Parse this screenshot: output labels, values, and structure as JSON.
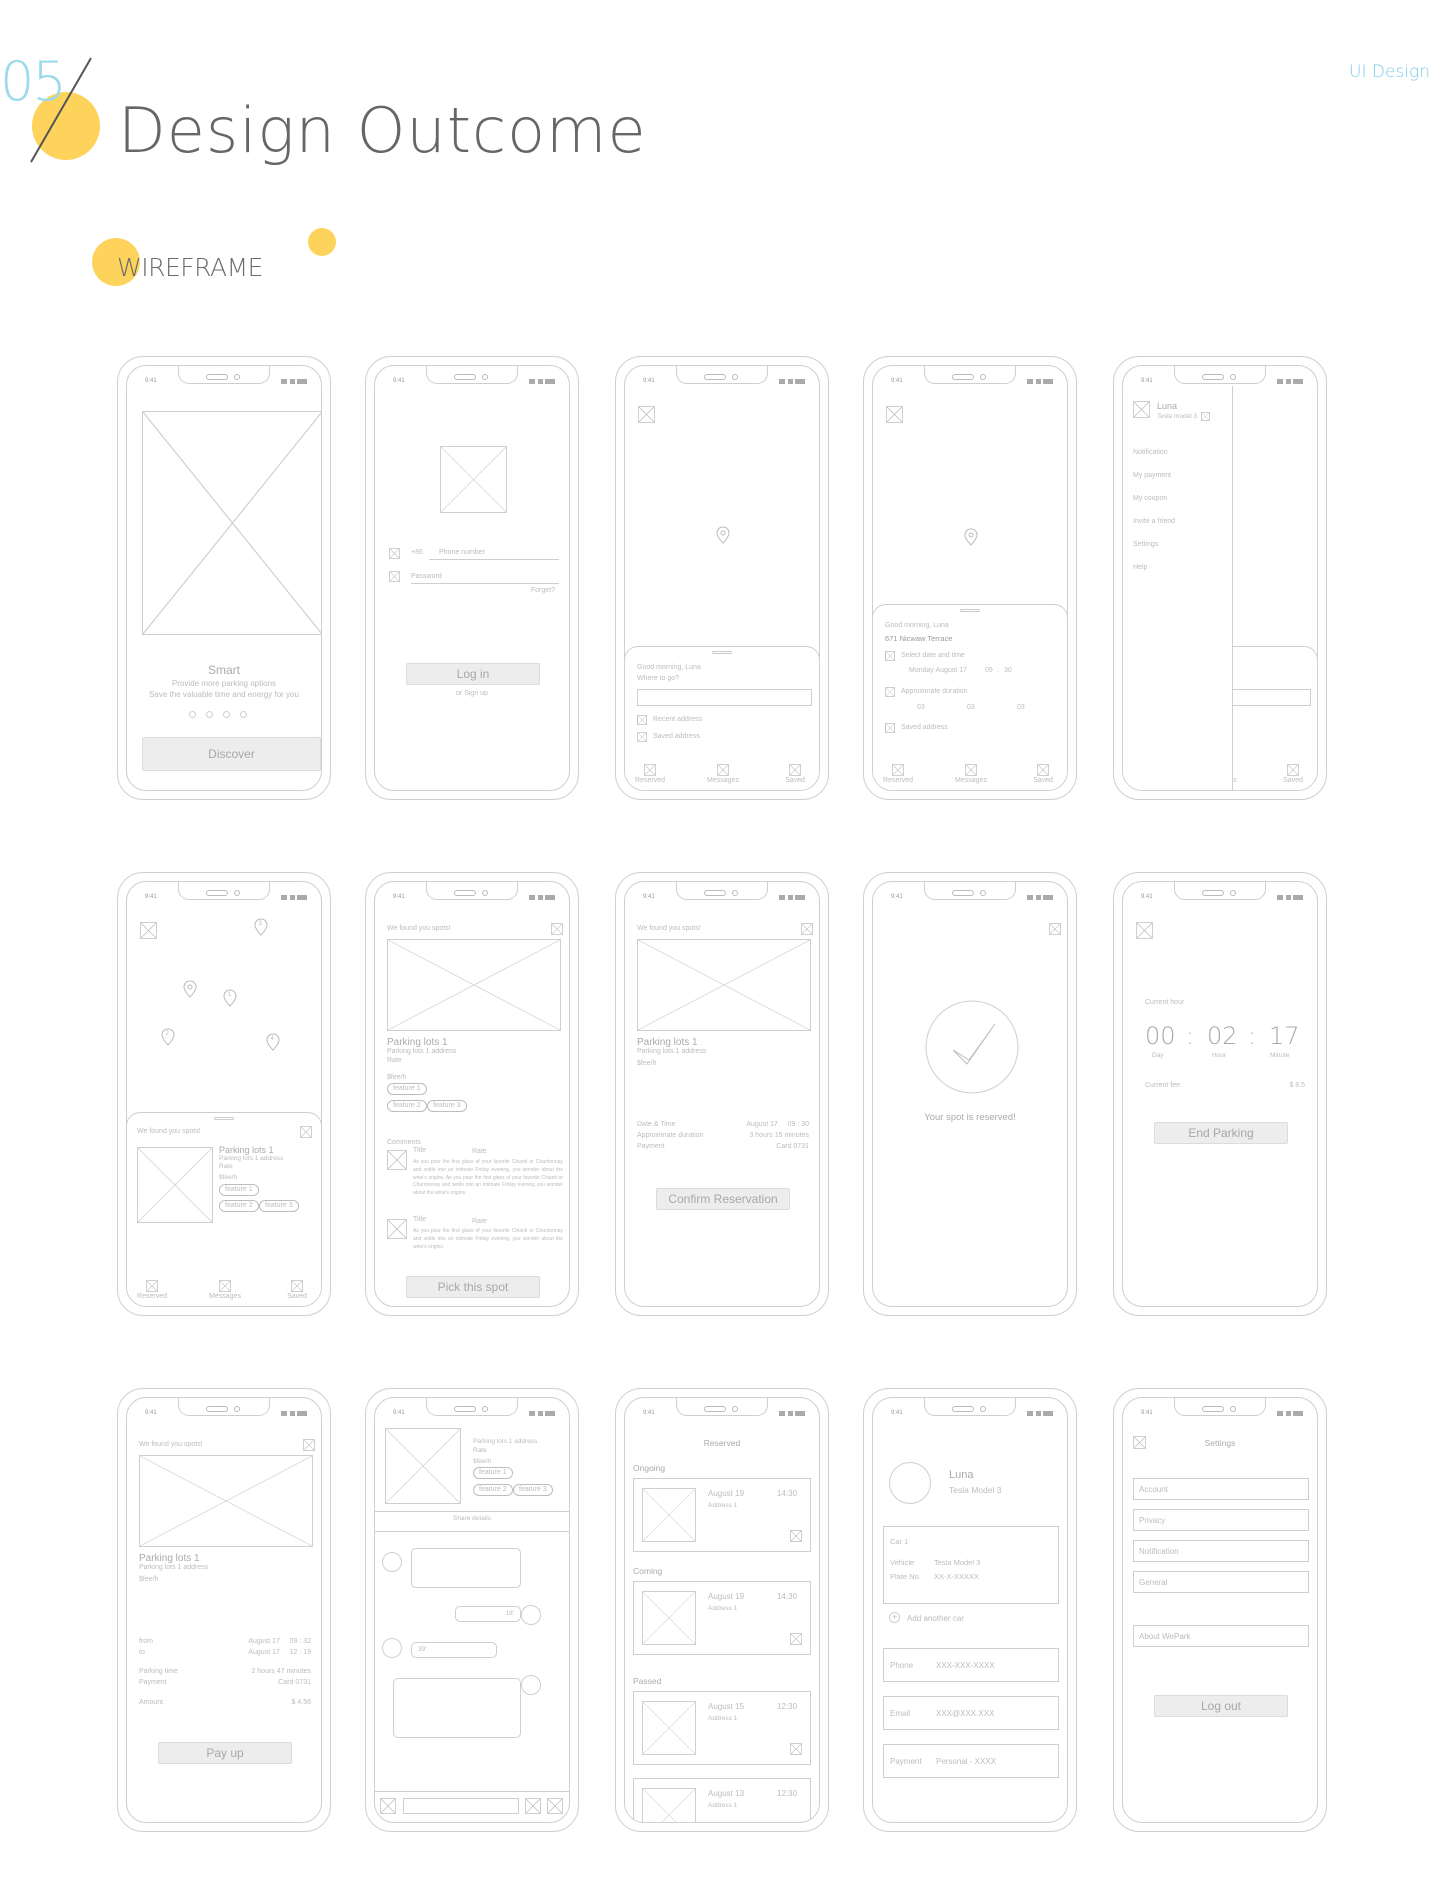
{
  "header": {
    "section_number": "05",
    "title": "Design Outcome",
    "tag": "UI Design",
    "subsection": "WIREFRAME"
  },
  "status_time": "9:41",
  "colors": {
    "accent_yellow": "#fdd35b",
    "accent_blue": "#9ad9ee",
    "wire": "#cfcfcf"
  },
  "tabs": {
    "reserved": "Reserved",
    "messages": "Messages",
    "saved": "Saved"
  },
  "s1": {
    "title": "Smart",
    "line1": "Provide more parking options",
    "line2": "Save the valuable time and energy for you",
    "button": "Discover"
  },
  "s2": {
    "code": "+86",
    "phone_placeholder": "Phone number",
    "password_placeholder": "Password",
    "forget": "Forget?",
    "login": "Log in",
    "signup": "or Sign up"
  },
  "s3": {
    "greeting": "Good morning, Luna",
    "question": "Where to go?",
    "recent": "Recent address",
    "saved": "Saved address"
  },
  "s4": {
    "greeting": "Good morning, Luna",
    "address": "671 Nicwaw Terrace",
    "select_dt": "Select date and time",
    "date": "Monday August 17",
    "hh": "09",
    "colon": ":",
    "mm": "30",
    "approx": "Approximate duration",
    "d1": "03",
    "d2": "03",
    "d3": "03",
    "saved": "Saved address"
  },
  "s5": {
    "name": "Luna",
    "car": "Tesla model 3",
    "menu": [
      "Notification",
      "My payment",
      "My coupon",
      "Invite a friend",
      "Settings",
      "Help"
    ],
    "partial_tab": "s"
  },
  "s6": {
    "pins": [
      "3",
      "1",
      "2",
      "4"
    ],
    "found": "We found you spots!",
    "lot": "Parking lots 1",
    "address": "Parking lots 1 address",
    "rate": "Rate",
    "fee": "$fee/h",
    "f1": "feature 1",
    "f2": "feature 2",
    "f3": "feature 3"
  },
  "s7": {
    "found": "We found you spots!",
    "lot": "Parking lots 1",
    "address": "Parking lots 1 address",
    "rate": "Rate",
    "fee": "$fee/h",
    "f1": "feature 1",
    "f2": "feature 2",
    "f3": "feature 3",
    "comments": "Comments",
    "c_title": "Title",
    "c_rate": "Rate",
    "c_body1": "As you pour the first glass of your favorite Chianti or Chardonnay and settle into an intimate Friday evening, you wonder about the wine's origins. As you pour the first glass of your favorite Chianti or Chardonnay and settle into an intimate Friday evening you wonder about the wine's origins.",
    "c_body2": "As you pour the first glass of your favorite Chianti or Chardonnay and settle into an intimate Friday evening, you wonder about the wine's origins.",
    "button": "Pick this spot"
  },
  "s8": {
    "found": "We found you spots!",
    "lot": "Parking lots 1",
    "address": "Parking lots 1 address",
    "fee": "$fee/h",
    "dt_label": "Date & Time",
    "dt_value": "August 17     09 : 30",
    "dur_label": "Approximate duration",
    "dur_value": "3 hours 15 minutes",
    "pay_label": "Payment",
    "pay_value": "Card 0731",
    "button": "Confirm Reservation"
  },
  "s9": {
    "message": "Your spot is reserved!"
  },
  "s10": {
    "current_hour": "Current hour",
    "h": "00",
    "m": "02",
    "s": "17",
    "sep": ":",
    "l1": "Day",
    "l2": "Hour",
    "l3": "Minute",
    "fee_label": "Current fee",
    "fee_value": "$ 8.5",
    "button": "End Parking"
  },
  "s11": {
    "found": "We found you spots!",
    "lot": "Parking lots 1",
    "address": "Parking lots 1 address",
    "fee": "$fee/h",
    "from": "from",
    "from_v": "August 17     09 : 32",
    "to": "to",
    "to_v": "August 17     12 : 19",
    "ptime": "Parking time",
    "ptime_v": "2 hours 47 minutes",
    "pay": "Payment",
    "pay_v": "Card 0731",
    "amount": "Amount",
    "amount_v": "$ 4.56",
    "button": "Pay up"
  },
  "s12": {
    "address": "Parking lots 1 address",
    "rate": "Rate",
    "fee": "$fee/h",
    "f1": "feature 1",
    "f2": "feature 2",
    "f3": "feature 3",
    "share": "Share details",
    "b1": "18'",
    "b2": "39'"
  },
  "s13": {
    "title": "Reserved",
    "ongoing": "Ongoing",
    "coming": "Coming",
    "passed": "Passed",
    "items": [
      {
        "date": "August 19",
        "time": "14:30",
        "addr": "Address 1"
      },
      {
        "date": "August 19",
        "time": "14:30",
        "addr": "Address 1"
      },
      {
        "date": "August 15",
        "time": "12:30",
        "addr": "Address 1"
      },
      {
        "date": "August 13",
        "time": "12:30",
        "addr": "Address 1"
      }
    ]
  },
  "s14": {
    "name": "Luna",
    "car": "Tesla Model 3",
    "car1": "Car 1",
    "vehicle": "Vehicle",
    "vehicle_v": "Tesla Model 3",
    "plate": "Plate No.",
    "plate_v": "XX-X-XXXXX",
    "add": "Add another car",
    "phone": "Phone",
    "phone_v": "XXX-XXX-XXXX",
    "email": "Email",
    "email_v": "XXX@XXX.XXX",
    "payment": "Payment",
    "payment_v": "Personal - XXXX"
  },
  "s15": {
    "title": "Settings",
    "items": [
      "Account",
      "Privacy",
      "Notification",
      "General"
    ],
    "about": "About WePark",
    "logout": "Log out"
  }
}
